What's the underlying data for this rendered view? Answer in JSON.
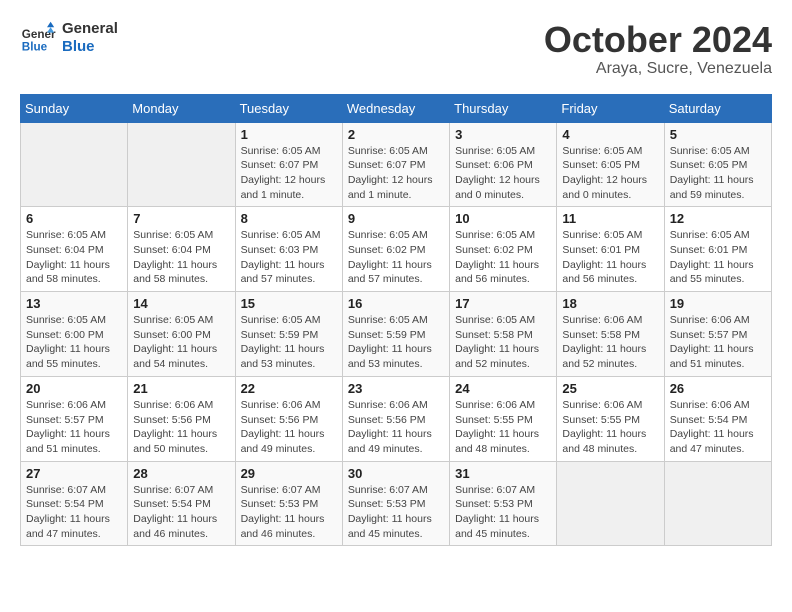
{
  "logo": {
    "line1": "General",
    "line2": "Blue"
  },
  "title": "October 2024",
  "subtitle": "Araya, Sucre, Venezuela",
  "weekdays": [
    "Sunday",
    "Monday",
    "Tuesday",
    "Wednesday",
    "Thursday",
    "Friday",
    "Saturday"
  ],
  "weeks": [
    [
      {
        "day": "",
        "info": ""
      },
      {
        "day": "",
        "info": ""
      },
      {
        "day": "1",
        "info": "Sunrise: 6:05 AM\nSunset: 6:07 PM\nDaylight: 12 hours\nand 1 minute."
      },
      {
        "day": "2",
        "info": "Sunrise: 6:05 AM\nSunset: 6:07 PM\nDaylight: 12 hours\nand 1 minute."
      },
      {
        "day": "3",
        "info": "Sunrise: 6:05 AM\nSunset: 6:06 PM\nDaylight: 12 hours\nand 0 minutes."
      },
      {
        "day": "4",
        "info": "Sunrise: 6:05 AM\nSunset: 6:05 PM\nDaylight: 12 hours\nand 0 minutes."
      },
      {
        "day": "5",
        "info": "Sunrise: 6:05 AM\nSunset: 6:05 PM\nDaylight: 11 hours\nand 59 minutes."
      }
    ],
    [
      {
        "day": "6",
        "info": "Sunrise: 6:05 AM\nSunset: 6:04 PM\nDaylight: 11 hours\nand 58 minutes."
      },
      {
        "day": "7",
        "info": "Sunrise: 6:05 AM\nSunset: 6:04 PM\nDaylight: 11 hours\nand 58 minutes."
      },
      {
        "day": "8",
        "info": "Sunrise: 6:05 AM\nSunset: 6:03 PM\nDaylight: 11 hours\nand 57 minutes."
      },
      {
        "day": "9",
        "info": "Sunrise: 6:05 AM\nSunset: 6:02 PM\nDaylight: 11 hours\nand 57 minutes."
      },
      {
        "day": "10",
        "info": "Sunrise: 6:05 AM\nSunset: 6:02 PM\nDaylight: 11 hours\nand 56 minutes."
      },
      {
        "day": "11",
        "info": "Sunrise: 6:05 AM\nSunset: 6:01 PM\nDaylight: 11 hours\nand 56 minutes."
      },
      {
        "day": "12",
        "info": "Sunrise: 6:05 AM\nSunset: 6:01 PM\nDaylight: 11 hours\nand 55 minutes."
      }
    ],
    [
      {
        "day": "13",
        "info": "Sunrise: 6:05 AM\nSunset: 6:00 PM\nDaylight: 11 hours\nand 55 minutes."
      },
      {
        "day": "14",
        "info": "Sunrise: 6:05 AM\nSunset: 6:00 PM\nDaylight: 11 hours\nand 54 minutes."
      },
      {
        "day": "15",
        "info": "Sunrise: 6:05 AM\nSunset: 5:59 PM\nDaylight: 11 hours\nand 53 minutes."
      },
      {
        "day": "16",
        "info": "Sunrise: 6:05 AM\nSunset: 5:59 PM\nDaylight: 11 hours\nand 53 minutes."
      },
      {
        "day": "17",
        "info": "Sunrise: 6:05 AM\nSunset: 5:58 PM\nDaylight: 11 hours\nand 52 minutes."
      },
      {
        "day": "18",
        "info": "Sunrise: 6:06 AM\nSunset: 5:58 PM\nDaylight: 11 hours\nand 52 minutes."
      },
      {
        "day": "19",
        "info": "Sunrise: 6:06 AM\nSunset: 5:57 PM\nDaylight: 11 hours\nand 51 minutes."
      }
    ],
    [
      {
        "day": "20",
        "info": "Sunrise: 6:06 AM\nSunset: 5:57 PM\nDaylight: 11 hours\nand 51 minutes."
      },
      {
        "day": "21",
        "info": "Sunrise: 6:06 AM\nSunset: 5:56 PM\nDaylight: 11 hours\nand 50 minutes."
      },
      {
        "day": "22",
        "info": "Sunrise: 6:06 AM\nSunset: 5:56 PM\nDaylight: 11 hours\nand 49 minutes."
      },
      {
        "day": "23",
        "info": "Sunrise: 6:06 AM\nSunset: 5:56 PM\nDaylight: 11 hours\nand 49 minutes."
      },
      {
        "day": "24",
        "info": "Sunrise: 6:06 AM\nSunset: 5:55 PM\nDaylight: 11 hours\nand 48 minutes."
      },
      {
        "day": "25",
        "info": "Sunrise: 6:06 AM\nSunset: 5:55 PM\nDaylight: 11 hours\nand 48 minutes."
      },
      {
        "day": "26",
        "info": "Sunrise: 6:06 AM\nSunset: 5:54 PM\nDaylight: 11 hours\nand 47 minutes."
      }
    ],
    [
      {
        "day": "27",
        "info": "Sunrise: 6:07 AM\nSunset: 5:54 PM\nDaylight: 11 hours\nand 47 minutes."
      },
      {
        "day": "28",
        "info": "Sunrise: 6:07 AM\nSunset: 5:54 PM\nDaylight: 11 hours\nand 46 minutes."
      },
      {
        "day": "29",
        "info": "Sunrise: 6:07 AM\nSunset: 5:53 PM\nDaylight: 11 hours\nand 46 minutes."
      },
      {
        "day": "30",
        "info": "Sunrise: 6:07 AM\nSunset: 5:53 PM\nDaylight: 11 hours\nand 45 minutes."
      },
      {
        "day": "31",
        "info": "Sunrise: 6:07 AM\nSunset: 5:53 PM\nDaylight: 11 hours\nand 45 minutes."
      },
      {
        "day": "",
        "info": ""
      },
      {
        "day": "",
        "info": ""
      }
    ]
  ]
}
